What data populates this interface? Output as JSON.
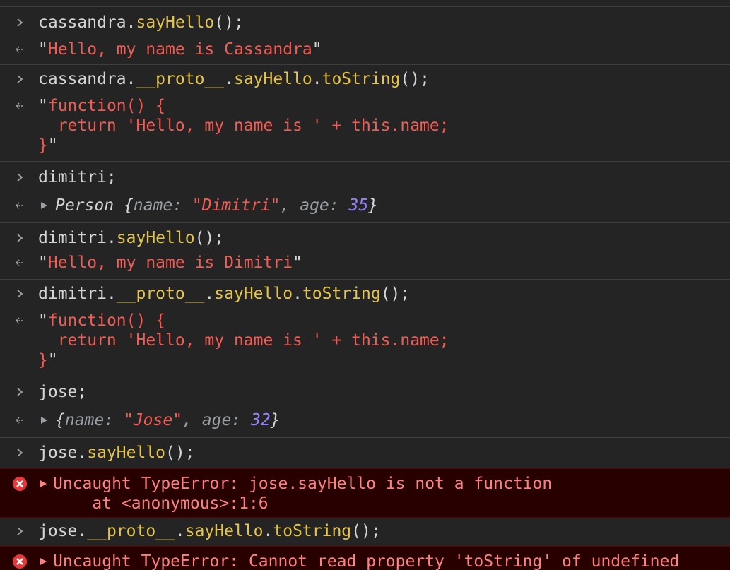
{
  "colors": {
    "background": "#242424",
    "method": "#e5c44a",
    "string": "#f25c54",
    "number": "#9980ff",
    "error_text": "#ff8080",
    "error_background": "#290000",
    "error_icon": "#e33b3b"
  },
  "icons": {
    "input_prompt": "chevron-right-icon",
    "output_marker": "return-arrow-icon",
    "expand": "triangle-right-icon",
    "error": "error-circle-icon"
  },
  "entries": {
    "e1_in": {
      "obj": "cassandra",
      "dot": ".",
      "method": "sayHello",
      "tail": "();"
    },
    "e1_out": {
      "q1": "\"",
      "text": "Hello, my name is Cassandra",
      "q2": "\""
    },
    "e2_in": {
      "obj": "cassandra",
      "dot1": ".",
      "proto": "__proto__",
      "dot2": ".",
      "method": "sayHello",
      "dot3": ".",
      "method2": "toString",
      "tail": "();"
    },
    "e2_out": {
      "q1": "\"",
      "line1": "function() {",
      "line2": "  return 'Hello, my name is ' + this.name;",
      "line3": "}",
      "q2": "\""
    },
    "e3_in": {
      "text": "dimitri;"
    },
    "e3_out": {
      "class": "Person",
      "open": " {",
      "k1": "name",
      "c1": ": ",
      "v1": "\"Dimitri\"",
      "sep": ", ",
      "k2": "age",
      "c2": ": ",
      "v2": "35",
      "close": "}"
    },
    "e4_in": {
      "obj": "dimitri",
      "dot": ".",
      "method": "sayHello",
      "tail": "();"
    },
    "e4_out": {
      "q1": "\"",
      "text": "Hello, my name is Dimitri",
      "q2": "\""
    },
    "e5_in": {
      "obj": "dimitri",
      "dot1": ".",
      "proto": "__proto__",
      "dot2": ".",
      "method": "sayHello",
      "dot3": ".",
      "method2": "toString",
      "tail": "();"
    },
    "e5_out": {
      "q1": "\"",
      "line1": "function() {",
      "line2": "  return 'Hello, my name is ' + this.name;",
      "line3": "}",
      "q2": "\""
    },
    "e6_in": {
      "text": "jose;"
    },
    "e6_out": {
      "open": "{",
      "k1": "name",
      "c1": ": ",
      "v1": "\"Jose\"",
      "sep": ", ",
      "k2": "age",
      "c2": ": ",
      "v2": "32",
      "close": "}"
    },
    "e7_in": {
      "obj": "jose",
      "dot": ".",
      "method": "sayHello",
      "tail": "();"
    },
    "e7_err": {
      "line1": "Uncaught TypeError: jose.sayHello is not a function",
      "line2": "    at <anonymous>:1:6"
    },
    "e8_in": {
      "obj": "jose",
      "dot1": ".",
      "proto": "__proto__",
      "dot2": ".",
      "method": "sayHello",
      "dot3": ".",
      "method2": "toString",
      "tail": "();"
    },
    "e8_err": {
      "line1": "Uncaught TypeError: Cannot read property 'toString' of undefined"
    }
  }
}
